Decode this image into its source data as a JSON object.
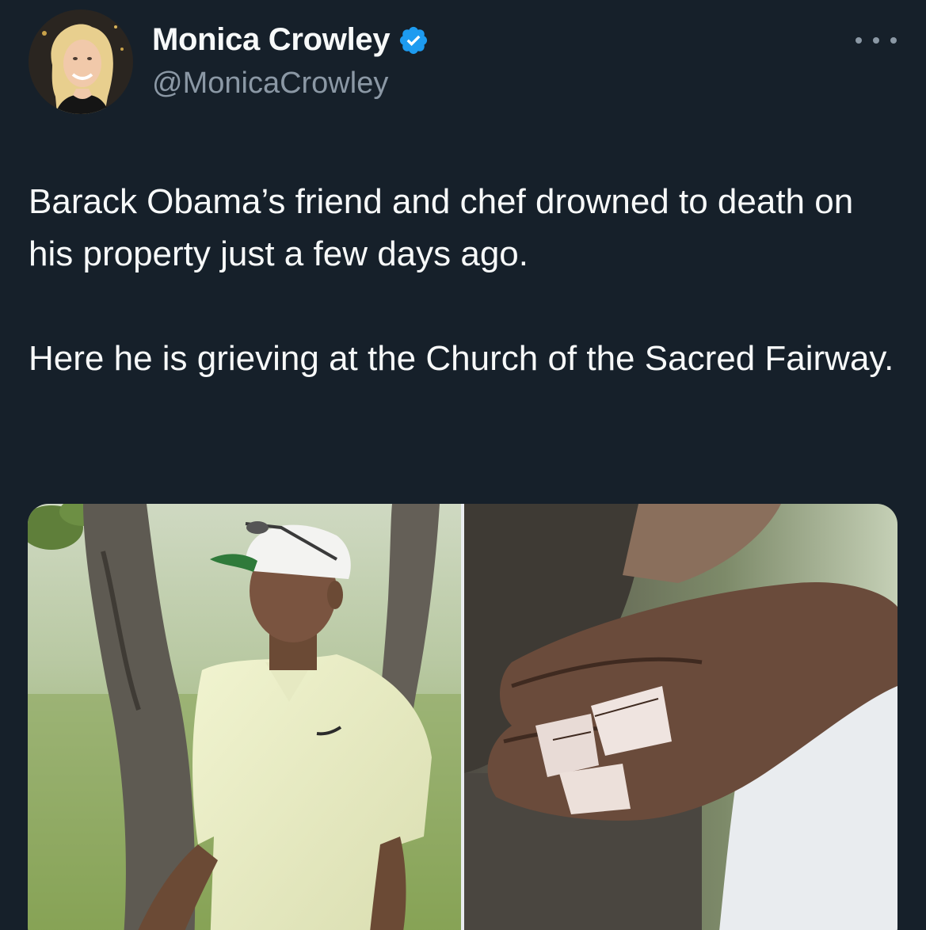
{
  "author": {
    "display_name": "Monica Crowley",
    "handle": "@MonicaCrowley",
    "verified": true,
    "verified_color": "#1d9bf0"
  },
  "tweet": {
    "paragraphs": [
      "Barack Obama’s friend and chef drowned to death on his property just a few days ago.",
      "Here he is grieving at the Church of the Sacred Fairway."
    ]
  },
  "media": {
    "photos": [
      {
        "icon": "golfer-photo"
      },
      {
        "icon": "taped-fingers-closeup-photo"
      }
    ]
  },
  "colors": {
    "background": "#16202a",
    "primary_text": "#f7f9f9",
    "secondary_text": "#8b98a5"
  },
  "icons": {
    "more": "more-dots-icon",
    "verified": "verified-badge-icon"
  }
}
